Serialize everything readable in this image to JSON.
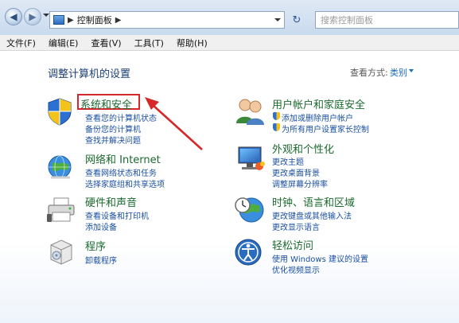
{
  "address_bar": {
    "back_icon": "back-arrow-icon",
    "forward_icon": "forward-arrow-icon",
    "path_root_icon": "control-panel-icon",
    "path_label": "控制面板",
    "refresh_icon": "refresh-icon",
    "search_placeholder": "搜索控制面板"
  },
  "menu": {
    "items": [
      "文件(F)",
      "编辑(E)",
      "查看(V)",
      "工具(T)",
      "帮助(H)"
    ]
  },
  "content": {
    "heading": "调整计算机的设置",
    "view_by_label": "查看方式:",
    "view_by_value": "类别"
  },
  "categories": [
    {
      "title": "系统和安全",
      "icon": "system-security-shield-icon",
      "links": [
        "查看您的计算机状态",
        "备份您的计算机",
        "查找并解决问题"
      ],
      "highlighted": true
    },
    {
      "title": "网络和 Internet",
      "icon": "network-globe-icon",
      "links": [
        "查看网络状态和任务",
        "选择家庭组和共享选项"
      ]
    },
    {
      "title": "硬件和声音",
      "icon": "printer-hardware-icon",
      "links": [
        "查看设备和打印机",
        "添加设备"
      ]
    },
    {
      "title": "程序",
      "icon": "programs-box-icon",
      "links": [
        "卸载程序"
      ]
    },
    {
      "title": "用户帐户和家庭安全",
      "icon": "users-icon",
      "links": [
        "添加或删除用户帐户",
        "为所有用户设置家长控制"
      ]
    },
    {
      "title": "外观和个性化",
      "icon": "appearance-monitor-icon",
      "links": [
        "更改主题",
        "更改桌面背景",
        "调整屏幕分辨率"
      ]
    },
    {
      "title": "时钟、语言和区域",
      "icon": "clock-globe-icon",
      "links": [
        "更改键盘或其他输入法",
        "更改显示语言"
      ]
    },
    {
      "title": "轻松访问",
      "icon": "ease-of-access-icon",
      "links": [
        "使用 Windows 建议的设置",
        "优化视频显示"
      ]
    }
  ],
  "colors": {
    "category_title": "#1b6a2e",
    "link": "#1a4fa0",
    "annotation_red": "#d6282b"
  }
}
